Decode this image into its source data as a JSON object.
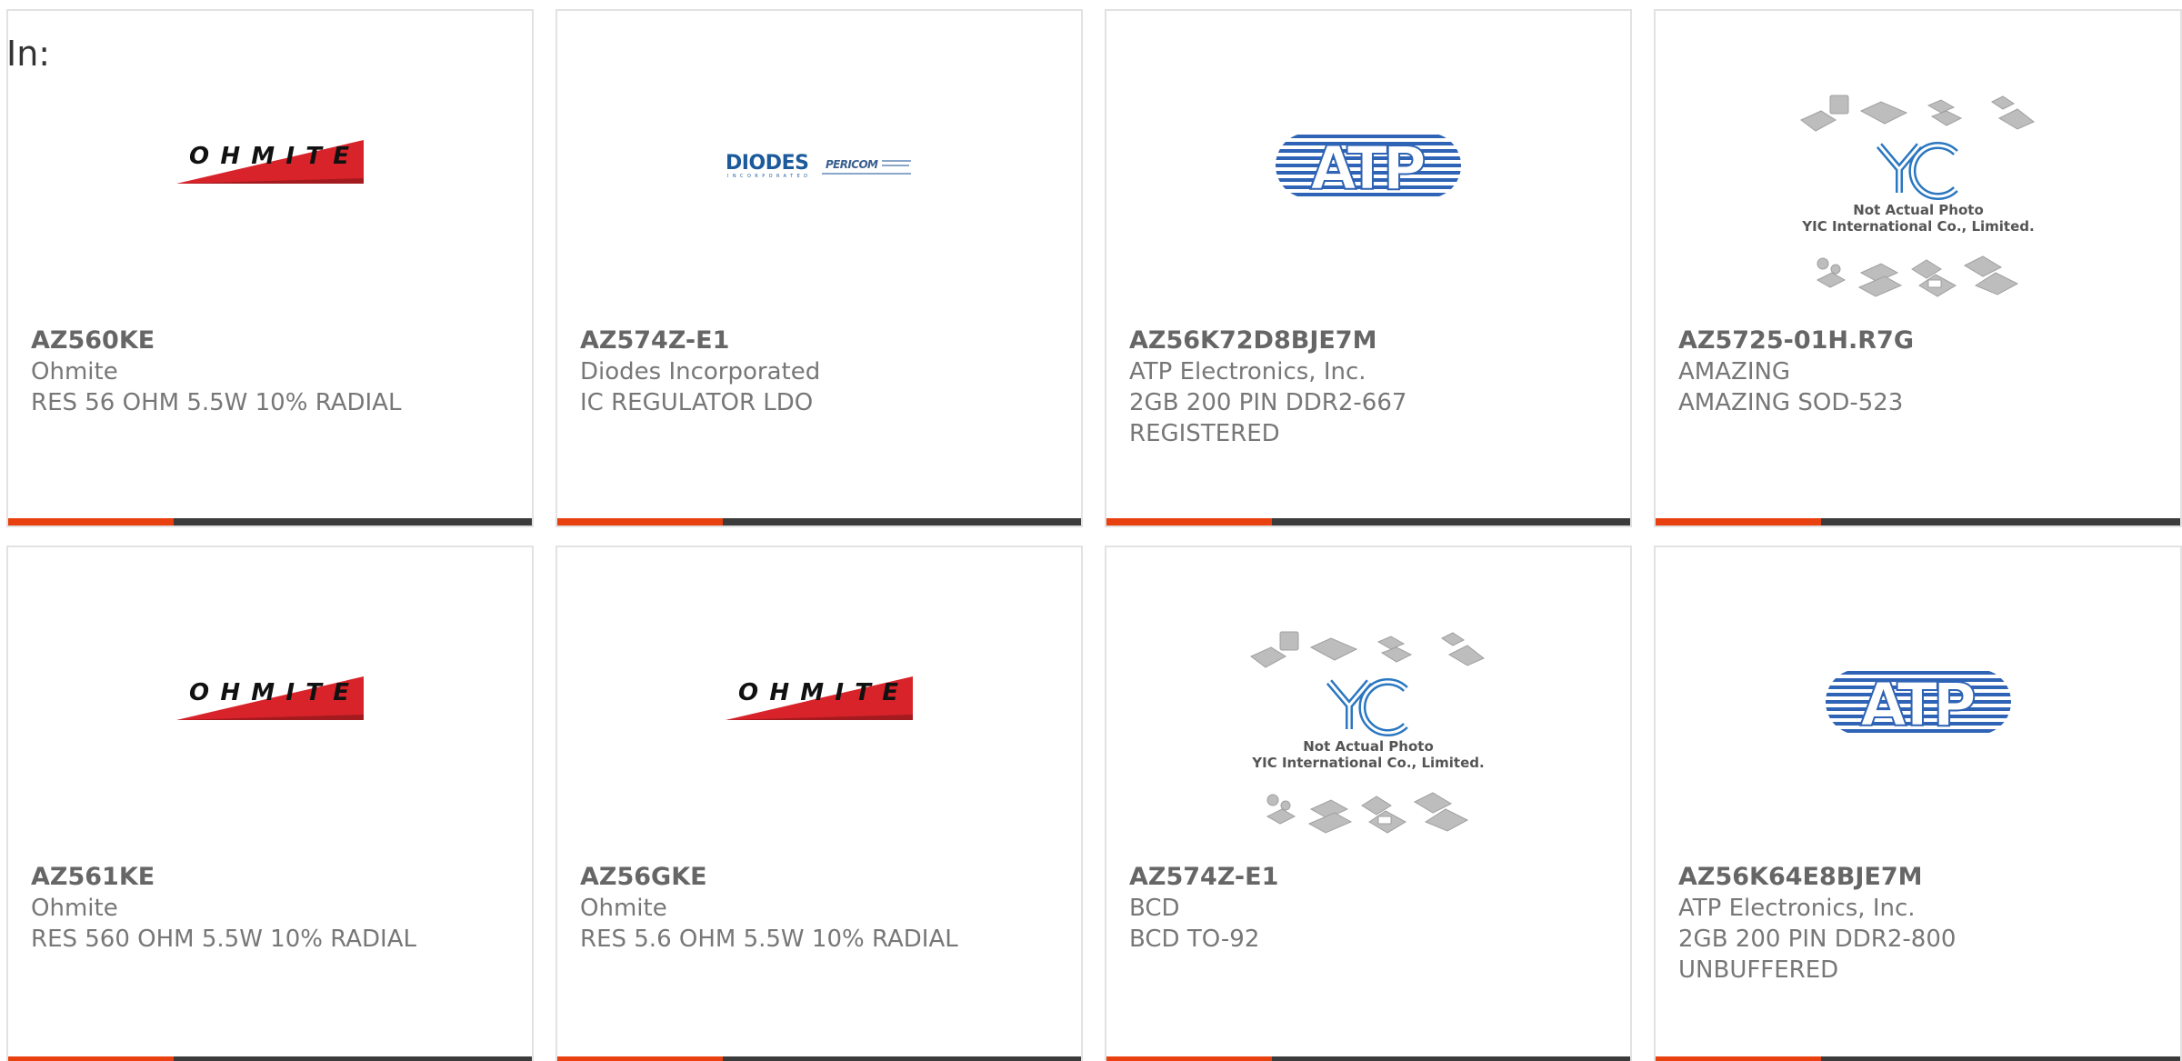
{
  "header": {
    "label": "In:"
  },
  "colors": {
    "accent": "#e8400f",
    "bar": "#3b3b3b",
    "border": "#e2e2e2",
    "text": "#777777"
  },
  "logos": {
    "ohmite": "OHMITE",
    "diodes": "DIODES",
    "diodes_sub": "INCORPORATED",
    "pericom": "PERICOM",
    "atp": "ATP",
    "yic_line1": "Not Actual Photo",
    "yic_line2": "YIC International Co., Limited."
  },
  "products": [
    {
      "part_number": "AZ560KE",
      "manufacturer": "Ohmite",
      "description": "RES 56 OHM 5.5W 10% RADIAL",
      "logo": "ohmite-logo"
    },
    {
      "part_number": "AZ574Z-E1",
      "manufacturer": "Diodes Incorporated",
      "description": "IC REGULATOR LDO",
      "logo": "diodes-logo"
    },
    {
      "part_number": "AZ56K72D8BJE7M",
      "manufacturer": "ATP Electronics, Inc.",
      "description": "2GB 200 PIN DDR2-667 REGISTERED",
      "logo": "atp-logo"
    },
    {
      "part_number": "AZ5725-01H.R7G",
      "manufacturer": "AMAZING",
      "description": "AMAZING SOD-523",
      "logo": "yic-placeholder"
    },
    {
      "part_number": "AZ561KE",
      "manufacturer": "Ohmite",
      "description": "RES 560 OHM 5.5W 10% RADIAL",
      "logo": "ohmite-logo"
    },
    {
      "part_number": "AZ56GKE",
      "manufacturer": "Ohmite",
      "description": "RES 5.6 OHM 5.5W 10% RADIAL",
      "logo": "ohmite-logo"
    },
    {
      "part_number": "AZ574Z-E1",
      "manufacturer": "BCD",
      "description": "BCD TO-92",
      "logo": "yic-placeholder"
    },
    {
      "part_number": "AZ56K64E8BJE7M",
      "manufacturer": "ATP Electronics, Inc.",
      "description": "2GB 200 PIN DDR2-800 UNBUFFERED",
      "logo": "atp-logo"
    }
  ]
}
